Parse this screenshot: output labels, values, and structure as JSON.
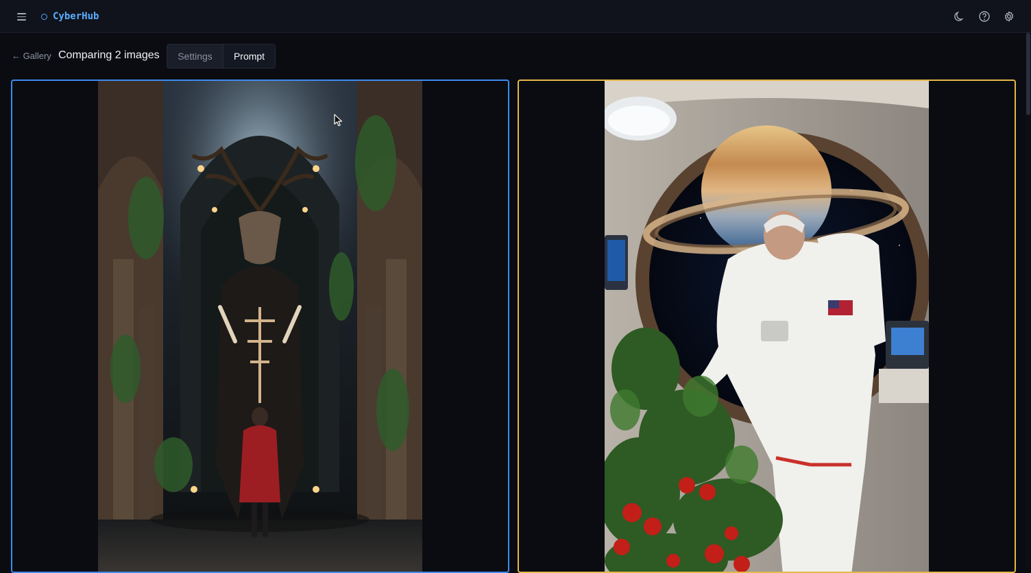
{
  "app": {
    "name": "CyberHub",
    "icons": [
      "menu-icon",
      "logo-icon",
      "moon-icon",
      "help-icon",
      "gear-icon"
    ]
  },
  "header": {
    "back_label": "← Gallery",
    "title": "Comparing 2 images",
    "tabs": [
      {
        "label": "Settings",
        "selected": false
      },
      {
        "label": "Prompt",
        "selected": true
      }
    ]
  },
  "images": [
    {
      "name": "Gothic cathedral forest stag with child in red cloak",
      "border_color": "#3d8bf0"
    },
    {
      "name": "Astronaut tending tomato plants by window to ringed planet",
      "border_color": "#e6b847"
    }
  ]
}
